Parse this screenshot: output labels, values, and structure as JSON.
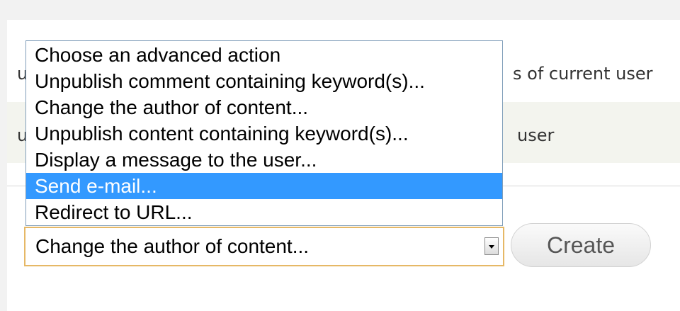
{
  "table": {
    "rows": [
      {
        "left_fragment": "u",
        "right_fragment": "s of current user"
      },
      {
        "left_fragment": "u",
        "right_fragment": "user"
      }
    ]
  },
  "action_select": {
    "current_value": "Change the author of content...",
    "options": [
      {
        "label": "Choose an advanced action",
        "highlighted": false
      },
      {
        "label": "Unpublish comment containing keyword(s)...",
        "highlighted": false
      },
      {
        "label": "Change the author of content...",
        "highlighted": false
      },
      {
        "label": "Unpublish content containing keyword(s)...",
        "highlighted": false
      },
      {
        "label": "Display a message to the user...",
        "highlighted": false
      },
      {
        "label": "Send e-mail...",
        "highlighted": true
      },
      {
        "label": "Redirect to URL...",
        "highlighted": false
      }
    ]
  },
  "buttons": {
    "create_label": "Create"
  },
  "icons": {
    "select_arrow": "chevron-down-icon"
  },
  "colors": {
    "highlight": "#3399ff",
    "highlight_text": "#ffffff",
    "select_focus_border": "#e6b866",
    "list_border": "#7f9db9"
  }
}
